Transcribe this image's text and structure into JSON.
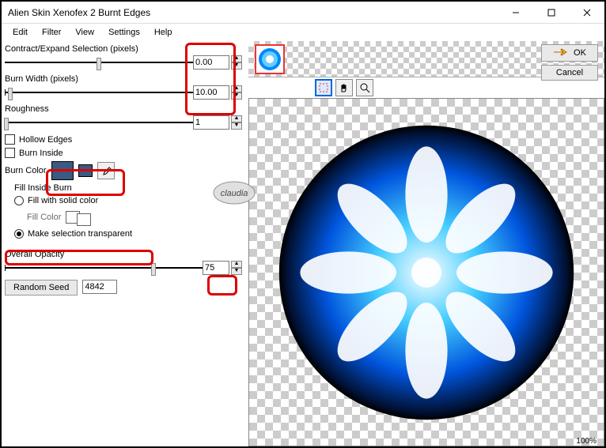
{
  "window": {
    "title": "Alien Skin Xenofex 2 Burnt Edges"
  },
  "menu": {
    "items": [
      "Edit",
      "Filter",
      "View",
      "Settings",
      "Help"
    ]
  },
  "params": {
    "contract_label": "Contract/Expand Selection (pixels)",
    "contract_val": "0.00",
    "burnwidth_label": "Burn Width (pixels)",
    "burnwidth_val": "10.00",
    "roughness_label": "Roughness",
    "roughness_val": "1",
    "hollow_label": "Hollow Edges",
    "burninside_label": "Burn Inside",
    "burncolor_label": "Burn Color",
    "fillinside_label": "Fill Inside Burn",
    "fillsolid_label": "Fill with solid color",
    "fillcolor_label": "Fill Color",
    "transparent_label": "Make selection transparent",
    "opacity_label": "Overall Opacity",
    "opacity_val": "75",
    "seed_btn": "Random Seed",
    "seed_val": "4842"
  },
  "colors": {
    "swatch1": "#3b5a82",
    "swatch2": "#3b5a82"
  },
  "buttons": {
    "ok": "OK",
    "cancel": "Cancel"
  },
  "preview": {
    "zoom": "100%"
  },
  "watermark": "claudia"
}
